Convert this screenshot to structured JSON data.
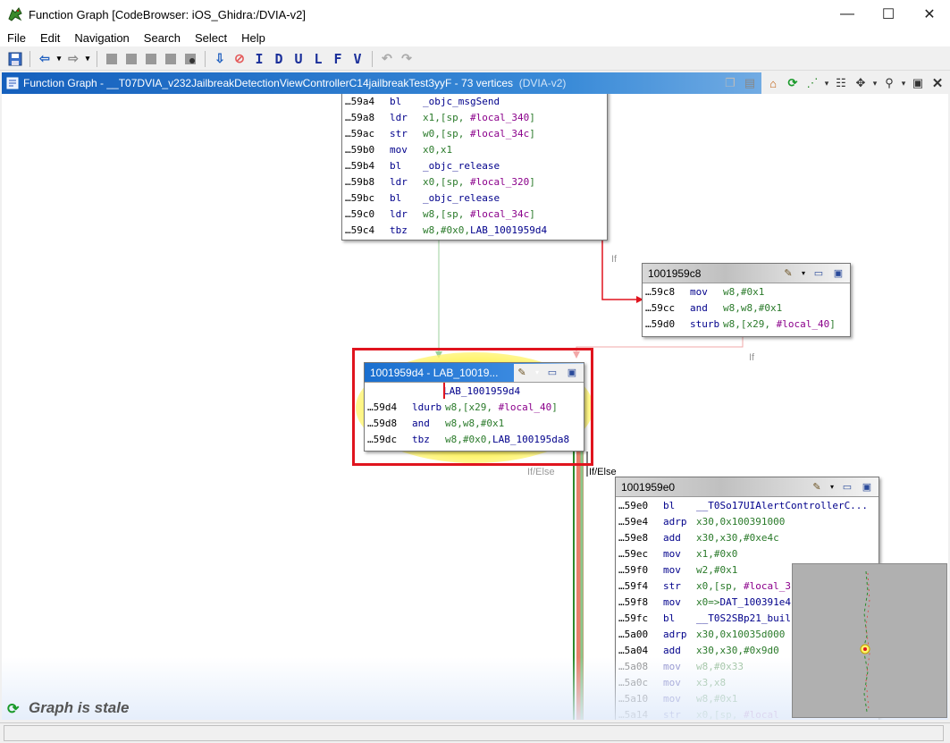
{
  "window": {
    "title": "Function Graph [CodeBrowser: iOS_Ghidra:/DVIA-v2]",
    "minimize": "—",
    "maximize": "☐",
    "close": "✕"
  },
  "menu": [
    "File",
    "Edit",
    "Navigation",
    "Search",
    "Select",
    "Help"
  ],
  "toolbar": {
    "letters": [
      "I",
      "D",
      "U",
      "L",
      "F",
      "V"
    ]
  },
  "panel": {
    "title": "Function Graph - __T07DVIA_v232JailbreakDetectionViewControllerC14jailbreakTest3yyF - 73 vertices",
    "program": "(DVIA-v2)"
  },
  "blocks": {
    "top": {
      "rows": [
        {
          "addr": "…59a4",
          "mn": "bl",
          "ops": [
            {
              "t": "sym",
              "v": "_objc_msgSend"
            }
          ]
        },
        {
          "addr": "…59a8",
          "mn": "ldr",
          "ops": [
            {
              "t": "reg",
              "v": "x1,[sp, "
            },
            {
              "t": "loc",
              "v": "#local_340"
            },
            {
              "t": "reg",
              "v": "]"
            }
          ]
        },
        {
          "addr": "…59ac",
          "mn": "str",
          "ops": [
            {
              "t": "reg",
              "v": "w0,[sp, "
            },
            {
              "t": "loc",
              "v": "#local_34c"
            },
            {
              "t": "reg",
              "v": "]"
            }
          ]
        },
        {
          "addr": "…59b0",
          "mn": "mov",
          "ops": [
            {
              "t": "reg",
              "v": "x0,x1"
            }
          ]
        },
        {
          "addr": "…59b4",
          "mn": "bl",
          "ops": [
            {
              "t": "sym",
              "v": "_objc_release"
            }
          ]
        },
        {
          "addr": "…59b8",
          "mn": "ldr",
          "ops": [
            {
              "t": "reg",
              "v": "x0,[sp, "
            },
            {
              "t": "loc",
              "v": "#local_320"
            },
            {
              "t": "reg",
              "v": "]"
            }
          ]
        },
        {
          "addr": "…59bc",
          "mn": "bl",
          "ops": [
            {
              "t": "sym",
              "v": "_objc_release"
            }
          ]
        },
        {
          "addr": "…59c0",
          "mn": "ldr",
          "ops": [
            {
              "t": "reg",
              "v": "w8,[sp, "
            },
            {
              "t": "loc",
              "v": "#local_34c"
            },
            {
              "t": "reg",
              "v": "]"
            }
          ]
        },
        {
          "addr": "…59c4",
          "mn": "tbz",
          "ops": [
            {
              "t": "reg",
              "v": "w8,#0x0,"
            },
            {
              "t": "sym",
              "v": "LAB_1001959d4"
            }
          ]
        }
      ]
    },
    "b9c8": {
      "name": "1001959c8",
      "rows": [
        {
          "addr": "…59c8",
          "mn": "mov",
          "ops": [
            {
              "t": "reg",
              "v": "w8,#0x1"
            }
          ]
        },
        {
          "addr": "…59cc",
          "mn": "and",
          "ops": [
            {
              "t": "reg",
              "v": "w8,w8,#0x1"
            }
          ]
        },
        {
          "addr": "…59d0",
          "mn": "sturb",
          "ops": [
            {
              "t": "reg",
              "v": "w8,[x29, "
            },
            {
              "t": "loc",
              "v": "#local_40"
            },
            {
              "t": "reg",
              "v": "]"
            }
          ]
        }
      ]
    },
    "b9d4": {
      "name": "1001959d4 - LAB_10019...",
      "label": "LAB_1001959d4",
      "rows": [
        {
          "addr": "…59d4",
          "mn": "ldurb",
          "ops": [
            {
              "t": "reg",
              "v": "w8,[x29, "
            },
            {
              "t": "loc",
              "v": "#local_40"
            },
            {
              "t": "reg",
              "v": "]"
            }
          ]
        },
        {
          "addr": "…59d8",
          "mn": "and",
          "ops": [
            {
              "t": "reg",
              "v": "w8,w8,#0x1"
            }
          ]
        },
        {
          "addr": "…59dc",
          "mn": "tbz",
          "ops": [
            {
              "t": "reg",
              "v": "w8,#0x0,"
            },
            {
              "t": "sym",
              "v": "LAB_100195da8"
            }
          ]
        }
      ]
    },
    "b9e0": {
      "name": "1001959e0",
      "rows": [
        {
          "addr": "…59e0",
          "mn": "bl",
          "ops": [
            {
              "t": "sym",
              "v": "__T0So17UIAlertControllerC..."
            }
          ]
        },
        {
          "addr": "…59e4",
          "mn": "adrp",
          "ops": [
            {
              "t": "reg",
              "v": "x30,0x100391000"
            }
          ]
        },
        {
          "addr": "…59e8",
          "mn": "add",
          "ops": [
            {
              "t": "reg",
              "v": "x30,x30,#0xe4c"
            }
          ]
        },
        {
          "addr": "…59ec",
          "mn": "mov",
          "ops": [
            {
              "t": "reg",
              "v": "x1,#0x0"
            }
          ]
        },
        {
          "addr": "…59f0",
          "mn": "mov",
          "ops": [
            {
              "t": "reg",
              "v": "w2,#0x1"
            }
          ]
        },
        {
          "addr": "…59f4",
          "mn": "str",
          "ops": [
            {
              "t": "reg",
              "v": "x0,[sp, "
            },
            {
              "t": "loc",
              "v": "#local_3"
            }
          ]
        },
        {
          "addr": "…59f8",
          "mn": "mov",
          "ops": [
            {
              "t": "reg",
              "v": "x0=>"
            },
            {
              "t": "sym",
              "v": "DAT_100391e4"
            }
          ]
        },
        {
          "addr": "…59fc",
          "mn": "bl",
          "ops": [
            {
              "t": "sym",
              "v": "__T0S2SBp21_buil"
            }
          ]
        },
        {
          "addr": "…5a00",
          "mn": "adrp",
          "ops": [
            {
              "t": "reg",
              "v": "x30,0x10035d000"
            }
          ]
        },
        {
          "addr": "…5a04",
          "mn": "add",
          "ops": [
            {
              "t": "reg",
              "v": "x30,x30,#0x9d0"
            }
          ]
        },
        {
          "addr": "…5a08",
          "mn": "mov",
          "ops": [
            {
              "t": "reg",
              "v": "w8,#0x33"
            }
          ]
        },
        {
          "addr": "…5a0c",
          "mn": "mov",
          "ops": [
            {
              "t": "reg",
              "v": "x3,x8"
            }
          ]
        },
        {
          "addr": "…5a10",
          "mn": "mov",
          "ops": [
            {
              "t": "reg",
              "v": "w8,#0x1"
            }
          ]
        },
        {
          "addr": "…5a14",
          "mn": "str",
          "ops": [
            {
              "t": "reg",
              "v": "x0,[sp, "
            },
            {
              "t": "loc",
              "v": "#local_"
            }
          ]
        }
      ]
    }
  },
  "edges": {
    "if_label": "If",
    "ifelse_label": "If/Else"
  },
  "status": {
    "stale": "Graph is stale"
  },
  "colors": {
    "accent": "#1560bd",
    "selected_outline": "#e0141e",
    "highlight": "#fff46a"
  }
}
